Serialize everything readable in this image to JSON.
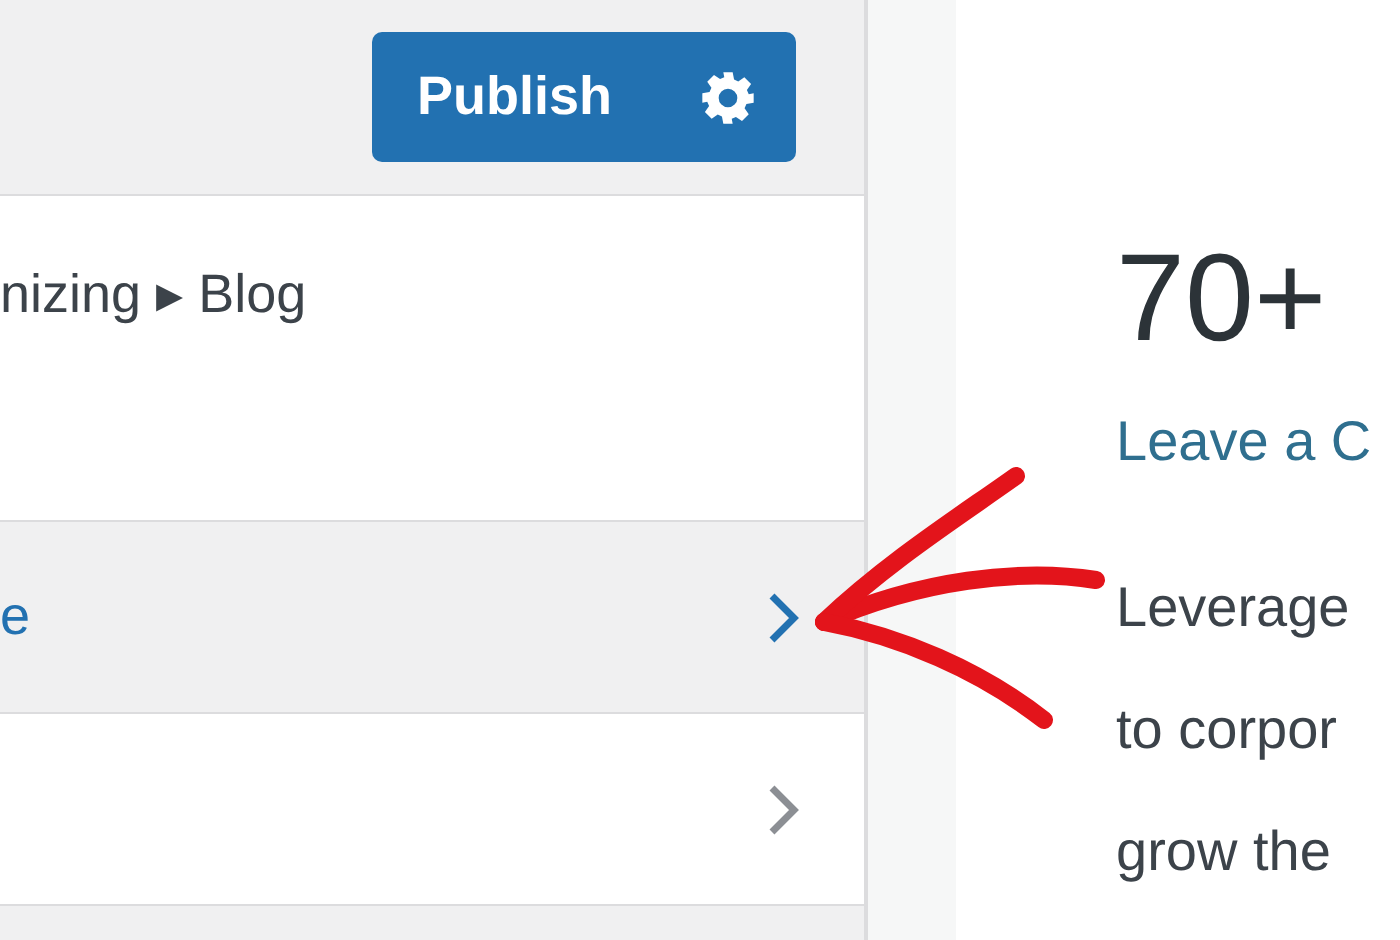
{
  "header": {
    "publish_button": {
      "label": "Publish"
    }
  },
  "breadcrumb": {
    "text": "nizing ▸ Blog"
  },
  "sections": [
    {
      "label": "e",
      "highlighted": true
    },
    {
      "highlighted": false
    }
  ],
  "preview": {
    "title": "70+",
    "link": "Leave a C",
    "paragraph_lines": [
      "Leverage",
      "to corpor",
      "grow the"
    ]
  }
}
